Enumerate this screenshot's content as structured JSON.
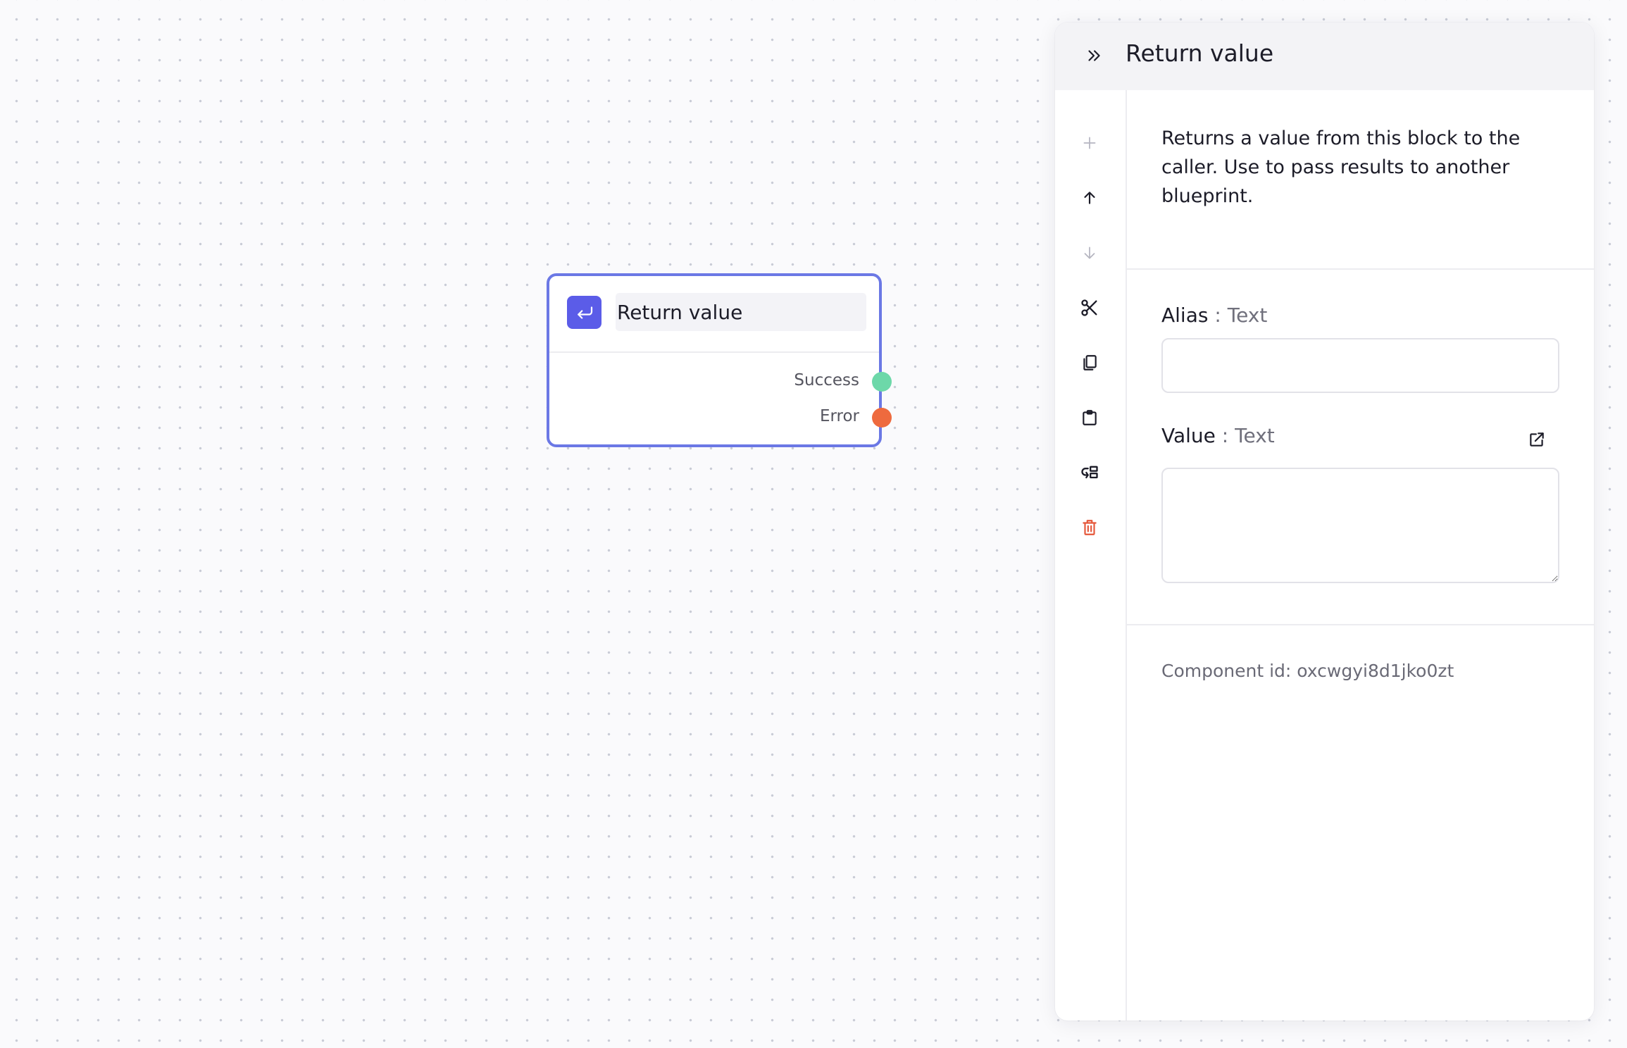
{
  "node": {
    "title": "Return value",
    "icon": "return-arrow-icon",
    "ports": [
      {
        "label": "Success",
        "color": "#6dd8a9"
      },
      {
        "label": "Error",
        "color": "#ee6a3e"
      }
    ],
    "accent_color": "#6b78e5",
    "icon_bg_color": "#5b5ce8"
  },
  "panel": {
    "title": "Return value",
    "collapse_icon": "double-chevron-right-icon",
    "toolbar": [
      {
        "name": "add-icon",
        "enabled": false
      },
      {
        "name": "arrow-up-icon",
        "enabled": true
      },
      {
        "name": "arrow-down-icon",
        "enabled": false
      },
      {
        "name": "cut-icon",
        "enabled": true
      },
      {
        "name": "copy-icon",
        "enabled": true
      },
      {
        "name": "paste-icon",
        "enabled": true
      },
      {
        "name": "move-to-icon",
        "enabled": true
      },
      {
        "name": "delete-icon",
        "enabled": true,
        "color": "#e5573a"
      }
    ],
    "description": "Returns a value from this block to the caller. Use to pass results to another blueprint.",
    "fields": {
      "alias": {
        "label": "Alias",
        "separator": ":",
        "type": "Text",
        "value": "",
        "placeholder": ""
      },
      "value": {
        "label": "Value",
        "separator": ":",
        "type": "Text",
        "value": "",
        "placeholder": "",
        "expand_icon": "open-in-new-icon"
      }
    },
    "component_id": "Component id: oxcwgyi8d1jko0zt"
  }
}
